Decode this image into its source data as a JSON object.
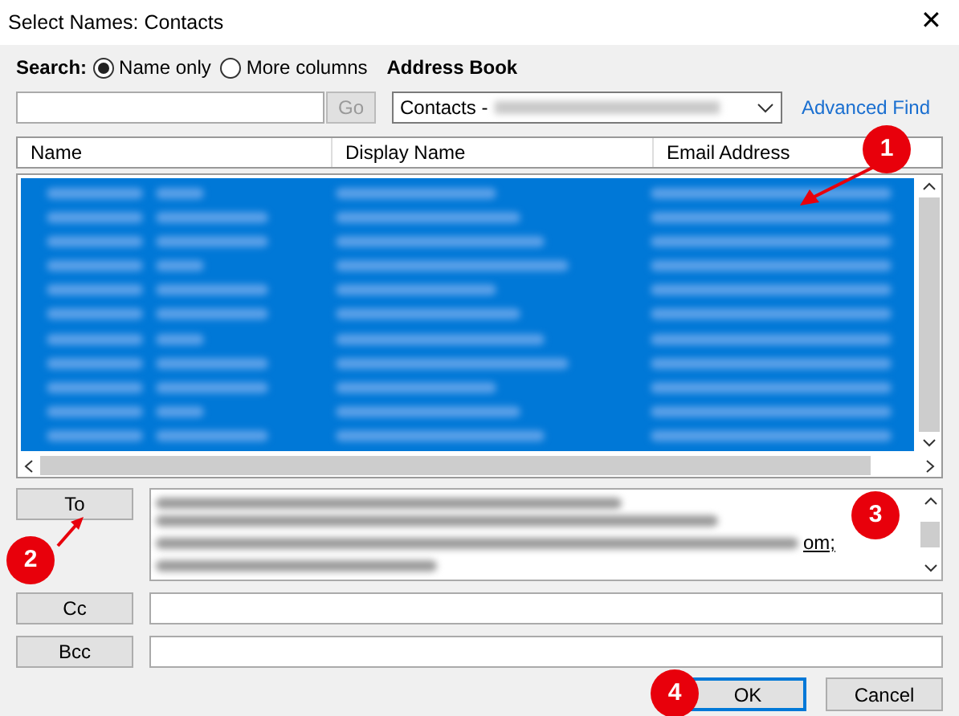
{
  "window": {
    "title": "Select Names: Contacts",
    "close": "✕"
  },
  "search": {
    "label": "Search:",
    "options": [
      {
        "label": "Name only",
        "selected": true
      },
      {
        "label": "More columns",
        "selected": false
      }
    ],
    "go": "Go",
    "go_disabled": true
  },
  "address_book": {
    "label": "Address Book",
    "value": "Contacts -"
  },
  "advanced_find": "Advanced Find",
  "table": {
    "columns": [
      "Name",
      "Display Name",
      "Email Address"
    ],
    "annotation": "1"
  },
  "recipients": [
    {
      "label": "To",
      "annotation": "2",
      "text": "om;",
      "field_annotation": "3",
      "kind": "multi"
    },
    {
      "label": "Cc",
      "kind": "single"
    },
    {
      "label": "Bcc",
      "kind": "single"
    }
  ],
  "buttons": [
    {
      "label": "OK",
      "default": true,
      "annotation": "4"
    },
    {
      "label": "Cancel",
      "default": false
    }
  ]
}
